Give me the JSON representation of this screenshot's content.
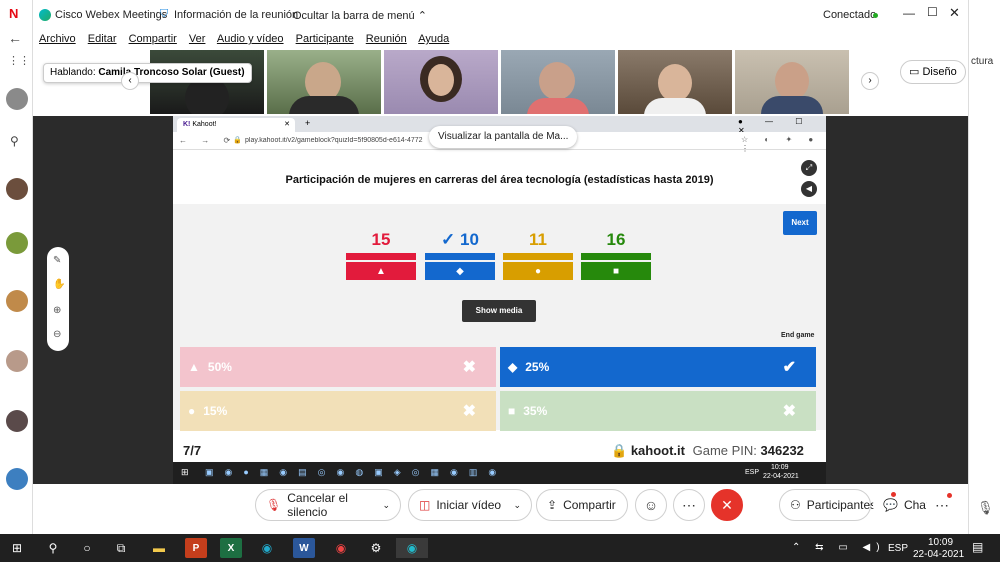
{
  "webex": {
    "app_title": "Cisco Webex Meetings",
    "meeting_info": "Información de la reunión",
    "hide_menu": "Ocultar la barra de menú",
    "status": "Conectado",
    "menu": [
      "Archivo",
      "Editar",
      "Compartir",
      "Ver",
      "Audio y vídeo",
      "Participante",
      "Reunión",
      "Ayuda"
    ],
    "speaking_label": "Hablando:",
    "speaking_name": "Camila Troncoso Solar (Guest)",
    "layout_button": "Diseño",
    "controls": {
      "mute": "Cancelar el silencio",
      "video": "Iniciar vídeo",
      "share": "Compartir",
      "participants": "Participantes",
      "chat": "Chat"
    }
  },
  "kahoot": {
    "tab_title": "Kahoot!",
    "url": "play.kahoot.it/v2/gameblock?quizId=5f90805d-e614-4772",
    "screen_label": "Visualizar la pantalla de Ma...",
    "question": "Participación de mujeres en carreras del área tecnología (estadísticas hasta 2019)",
    "next": "Next",
    "show_media": "Show media",
    "end_game": "End game",
    "counts": [
      {
        "value": "15",
        "color": "#e21b3c",
        "shape": "▲"
      },
      {
        "value": "✓ 10",
        "color": "#1368ce",
        "shape": "◆"
      },
      {
        "value": "11",
        "color": "#d89e00",
        "shape": "●"
      },
      {
        "value": "16",
        "color": "#26890c",
        "shape": "■"
      }
    ],
    "answers": [
      {
        "label": "50%",
        "shape": "▲",
        "mark": "✖",
        "bg": "#f3c4cd"
      },
      {
        "label": "25%",
        "shape": "◆",
        "mark": "✔",
        "bg": "#1368ce"
      },
      {
        "label": "15%",
        "shape": "●",
        "mark": "✖",
        "bg": "#f2e0b8"
      },
      {
        "label": "35%",
        "shape": "■",
        "mark": "✖",
        "bg": "#c9e0c3"
      }
    ],
    "progress": "7/7",
    "site": "kahoot.it",
    "pin_label": "Game PIN:",
    "pin": "346232",
    "inner_clock": "10:09",
    "inner_date": "22-04-2021",
    "inner_lang": "ESP"
  },
  "taskbar": {
    "time": "10:09",
    "date": "22-04-2021",
    "lang": "ESP"
  },
  "background": {
    "right_text": "ctura"
  }
}
